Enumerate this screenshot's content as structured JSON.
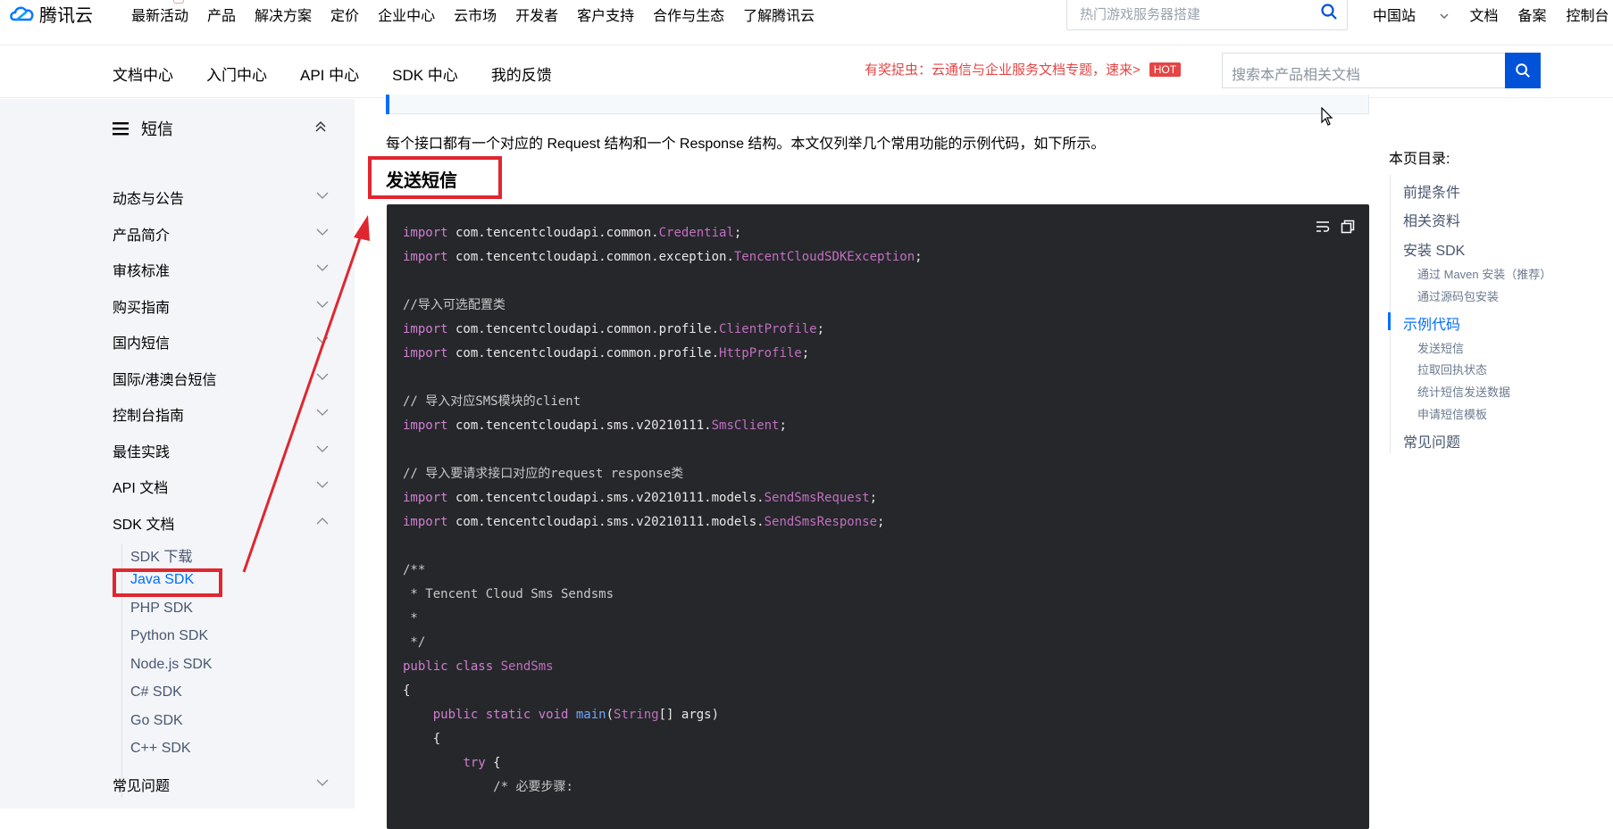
{
  "top_nav": {
    "logo_text": "腾讯云",
    "items": [
      "最新活动",
      "产品",
      "解决方案",
      "定价",
      "企业中心",
      "云市场",
      "开发者",
      "客户支持",
      "合作与生态",
      "了解腾讯云"
    ],
    "search_placeholder": "热门游戏服务器搭建",
    "right_items": [
      "中国站",
      "文档",
      "备案",
      "控制台"
    ]
  },
  "sub_nav": {
    "items": [
      "文档中心",
      "入门中心",
      "API 中心",
      "SDK 中心",
      "我的反馈"
    ],
    "promo_text": "有奖捉虫：云通信与企业服务文档专题，速来>",
    "hot_badge": "HOT",
    "search_placeholder": "搜索本产品相关文档"
  },
  "sidebar": {
    "title": "短信",
    "items": [
      "动态与公告",
      "产品简介",
      "审核标准",
      "购买指南",
      "国内短信",
      "国际/港澳台短信",
      "控制台指南",
      "最佳实践",
      "API 文档",
      "SDK 文档"
    ],
    "sdk_subitems": [
      "SDK 下载",
      "Java SDK",
      "PHP SDK",
      "Python SDK",
      "Node.js SDK",
      "C# SDK",
      "Go SDK",
      "C++ SDK"
    ],
    "active_subitem": "Java SDK",
    "last_item": "常见问题"
  },
  "main": {
    "intro": "每个接口都有一个对应的 Request 结构和一个 Response 结构。本文仅列举几个常用功能的示例代码，如下所示。",
    "section_title": "发送短信"
  },
  "toc": {
    "title": "本页目录:",
    "items": [
      {
        "label": "前提条件",
        "level": 1
      },
      {
        "label": "相关资料",
        "level": 1
      },
      {
        "label": "安装 SDK",
        "level": 1
      },
      {
        "label": "通过 Maven 安装（推荐）",
        "level": 2
      },
      {
        "label": "通过源码包安装",
        "level": 2
      },
      {
        "label": "示例代码",
        "level": 1,
        "active": true
      },
      {
        "label": "发送短信",
        "level": 2
      },
      {
        "label": "拉取回执状态",
        "level": 2
      },
      {
        "label": "统计短信发送数据",
        "level": 2
      },
      {
        "label": "申请短信模板",
        "level": 2
      },
      {
        "label": "常见问题",
        "level": 1
      }
    ]
  },
  "colors": {
    "accent_blue": "#006eff",
    "button_blue": "#0052d9",
    "annotation_red": "#e0262f",
    "code_bg": "#26272b",
    "sidebar_bg": "#f3f5f8"
  }
}
